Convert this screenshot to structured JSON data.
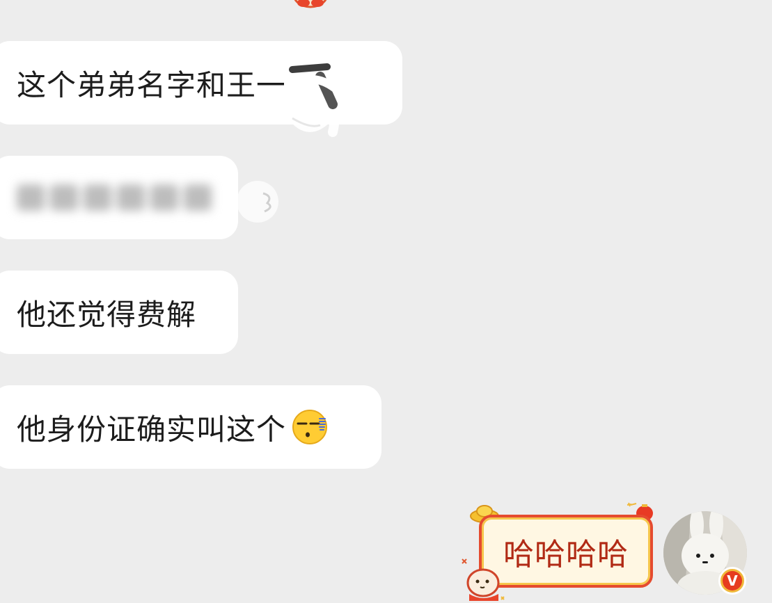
{
  "messages": [
    {
      "sender": "other",
      "text": "这个弟弟名字和王一博像",
      "censored": true
    },
    {
      "sender": "other",
      "text": "",
      "blurred": true
    },
    {
      "sender": "other",
      "text": "他还觉得费解"
    },
    {
      "sender": "other",
      "text": "他身份证确实叫这个",
      "emoji": "sweat-smirk-emoji"
    }
  ],
  "my_message": {
    "text": "哈哈哈哈",
    "bubble_style": "lunar-new-year-bubble"
  },
  "avatar": {
    "badge_text": "V",
    "badge_color": "#e63c1f"
  },
  "colors": {
    "background": "#ededed",
    "bubble": "#ffffff",
    "my_bubble_border": "#e54b2f",
    "my_bubble_text": "#b12a15"
  }
}
